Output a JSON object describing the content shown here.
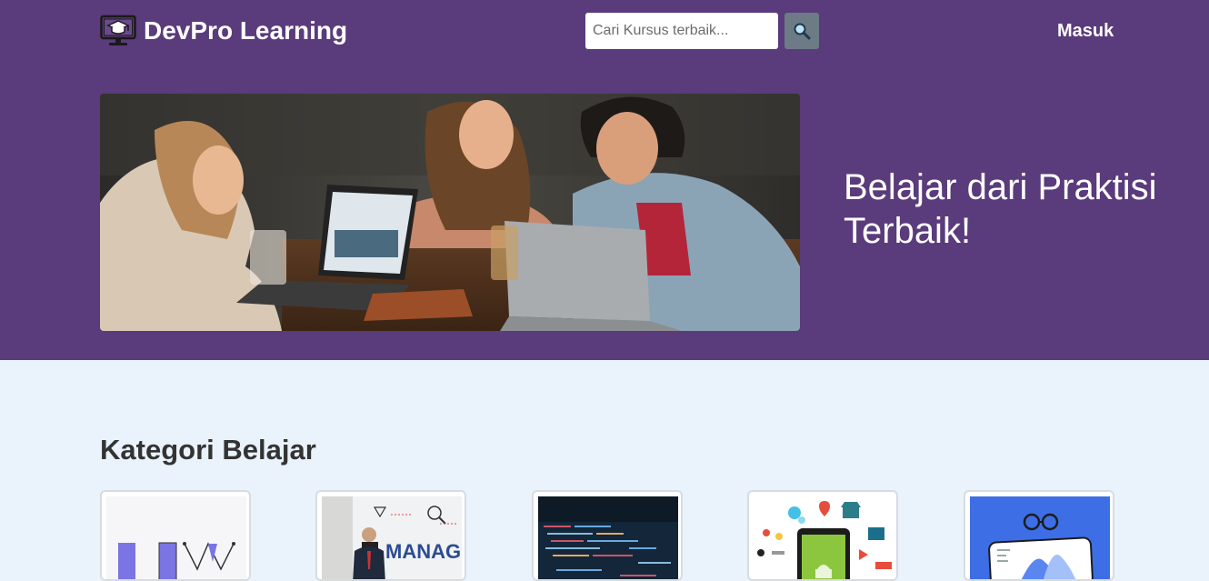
{
  "header": {
    "brand": "DevPro Learning",
    "logo_icon": "monitor-graduation-cap-icon",
    "search": {
      "placeholder": "Cari Kursus terbaik...",
      "value": "",
      "icon": "search-icon"
    },
    "login_label": "Masuk"
  },
  "hero": {
    "heading": "Belajar dari Praktisi Terbaik!",
    "image": "three-people-laughing-with-laptops-photo"
  },
  "categories": {
    "title": "Kategori Belajar",
    "items": [
      {
        "image": "ui-design-illustration"
      },
      {
        "image": "management-whiteboard-photo"
      },
      {
        "image": "code-on-screen-photo"
      },
      {
        "image": "android-app-illustration"
      },
      {
        "image": "data-analytics-illustration"
      }
    ]
  },
  "colors": {
    "header_bg": "#5a3b7b",
    "page_bg": "#eaf3fb",
    "search_button": "#6c7b86",
    "text_dark": "#333333"
  }
}
